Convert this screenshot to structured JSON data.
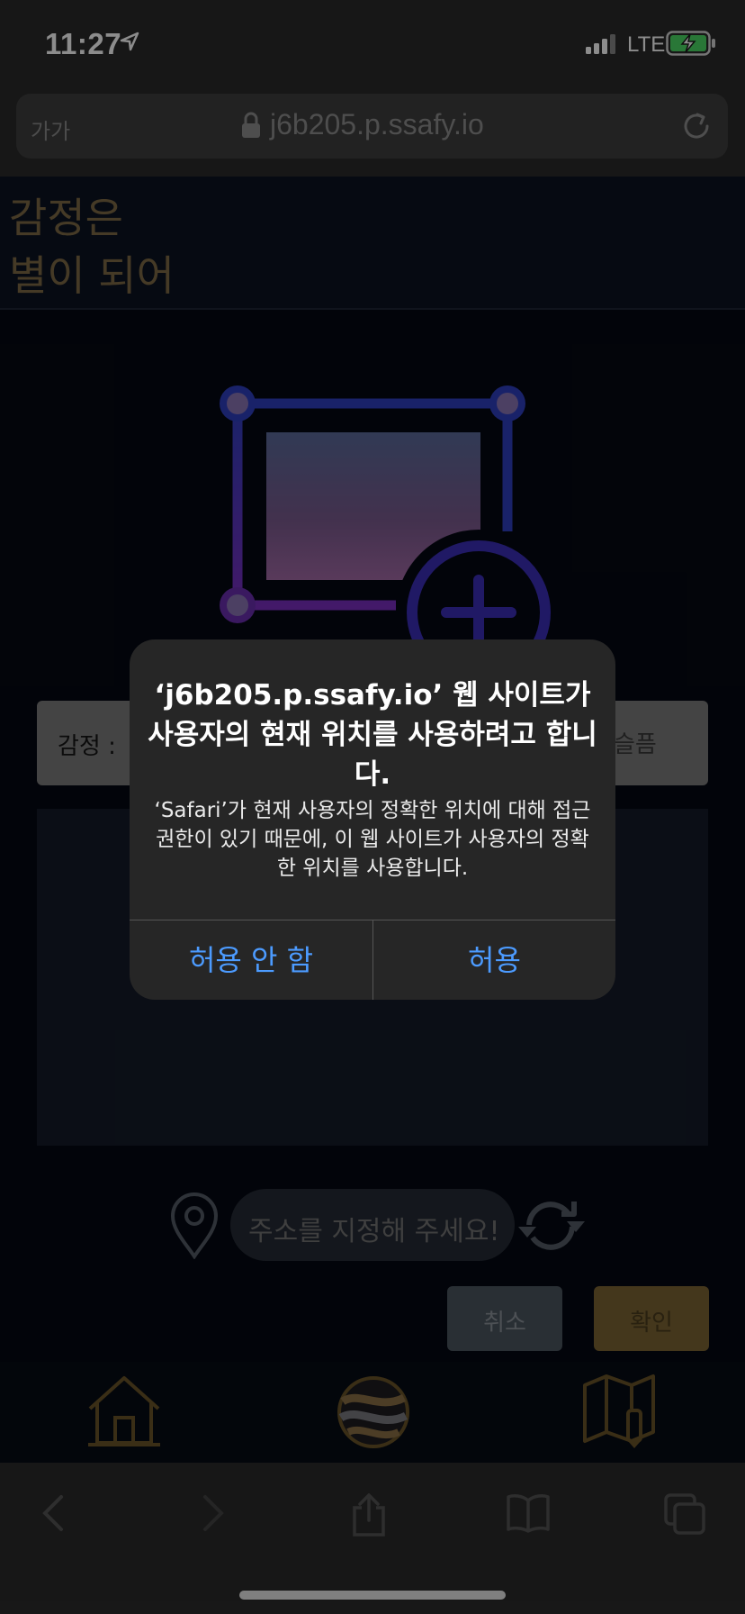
{
  "status_bar": {
    "time": "11:27",
    "network": "LTE"
  },
  "browser": {
    "text_size_label": "가가",
    "url": "j6b205.p.ssafy.io"
  },
  "page": {
    "title_line1": "감정은",
    "title_line2": "별이 되어",
    "emotion_label": "감정 :",
    "emotion_value": "슬픔",
    "address_placeholder": "주소를 지정해 주세요!",
    "cancel_label": "취소",
    "confirm_label": "확인"
  },
  "alert": {
    "title": "‘j6b205.p.ssafy.io’ 웹 사이트가 사용자의 현재 위치를 사용하려고 합니다.",
    "message": "‘Safari’가 현재 사용자의 정확한 위치에 대해 접근 권한이 있기 때문에, 이 웹 사이트가 사용자의 정확한 위치를 사용합니다.",
    "deny_label": "허용 안 함",
    "allow_label": "허용"
  },
  "colors": {
    "accent_gold": "#c9a35a",
    "alert_button_blue": "#4c9bff",
    "illustration_blue": "#2f3fbf",
    "illustration_purple": "#7a2fbf"
  },
  "icons": {
    "nav": [
      "home-icon",
      "globe-icon",
      "map-icon"
    ],
    "toolbar": [
      "back-icon",
      "forward-icon",
      "share-icon",
      "bookmarks-icon",
      "tabs-icon"
    ]
  }
}
